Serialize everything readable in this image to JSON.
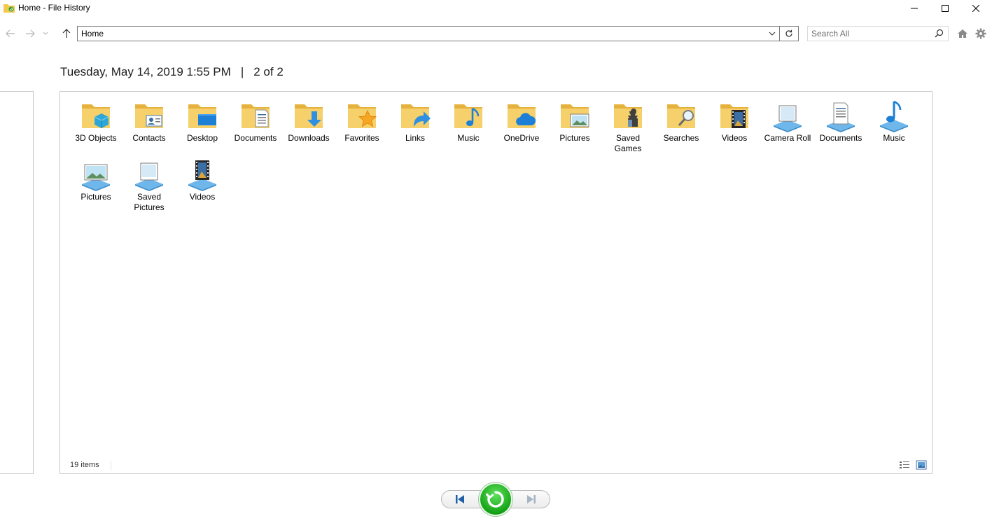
{
  "window": {
    "title": "Home - File History"
  },
  "address": {
    "path": "Home"
  },
  "search": {
    "placeholder": "Search All"
  },
  "snapshot": {
    "date": "Tuesday, May 14, 2019 1:55 PM",
    "separator": "|",
    "position": "2 of 2"
  },
  "items": [
    {
      "label": "3D Objects",
      "icon": "folder-3d-objects-icon"
    },
    {
      "label": "Contacts",
      "icon": "folder-contacts-icon"
    },
    {
      "label": "Desktop",
      "icon": "folder-desktop-icon"
    },
    {
      "label": "Documents",
      "icon": "folder-documents-icon"
    },
    {
      "label": "Downloads",
      "icon": "folder-downloads-icon"
    },
    {
      "label": "Favorites",
      "icon": "folder-favorites-icon"
    },
    {
      "label": "Links",
      "icon": "folder-links-icon"
    },
    {
      "label": "Music",
      "icon": "folder-music-icon"
    },
    {
      "label": "OneDrive",
      "icon": "folder-onedrive-icon"
    },
    {
      "label": "Pictures",
      "icon": "folder-pictures-icon"
    },
    {
      "label": "Saved Games",
      "icon": "folder-saved-games-icon"
    },
    {
      "label": "Searches",
      "icon": "folder-searches-icon"
    },
    {
      "label": "Videos",
      "icon": "folder-videos-icon"
    },
    {
      "label": "Camera Roll",
      "icon": "library-camera-roll-icon"
    },
    {
      "label": "Documents",
      "icon": "library-documents-icon"
    },
    {
      "label": "Music",
      "icon": "library-music-icon"
    },
    {
      "label": "Pictures",
      "icon": "library-pictures-icon"
    },
    {
      "label": "Saved Pictures",
      "icon": "library-saved-pictures-icon"
    },
    {
      "label": "Videos",
      "icon": "library-videos-icon"
    }
  ],
  "status": {
    "item_count": "19 items"
  },
  "colors": {
    "folder": "#f2c94c",
    "accent_blue": "#1e88e5",
    "restore_green": "#16a316"
  }
}
